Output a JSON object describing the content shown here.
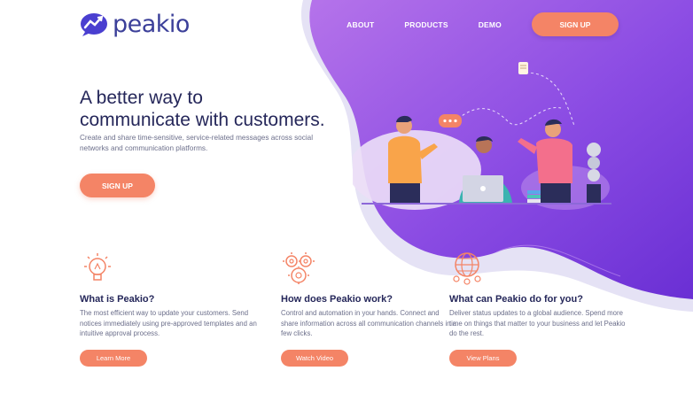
{
  "brand": {
    "name": "peakio"
  },
  "nav": {
    "links": [
      "ABOUT",
      "PRODUCTS",
      "DEMO"
    ],
    "signup_label": "SIGN UP"
  },
  "hero": {
    "title_line1": "A better way to",
    "title_line2": "communicate with customers.",
    "subtitle": "Create and share time-sensitive, service-related messages across social networks and communication platforms.",
    "signup_label": "SIGN UP"
  },
  "features": [
    {
      "icon": "lightbulb-icon",
      "title": "What is Peakio?",
      "text": "The most efficient way to update your customers. Send notices immediately using pre-approved templates and an intuitive approval process.",
      "button": "Learn More"
    },
    {
      "icon": "gears-icon",
      "title": "How does Peakio work?",
      "text": "Control and automation in your hands. Connect and share information across all communication channels in a few clicks.",
      "button": "Watch Video"
    },
    {
      "icon": "globe-network-icon",
      "title": "What can Peakio do for you?",
      "text": "Deliver status updates to a global audience. Spend more time on things that matter to your business and let Peakio do the rest.",
      "button": "View Plans"
    }
  ],
  "colors": {
    "purple_light": "#a66ce6",
    "purple_dark": "#6c32d6",
    "coral": "#f48466",
    "navy": "#25275a"
  }
}
